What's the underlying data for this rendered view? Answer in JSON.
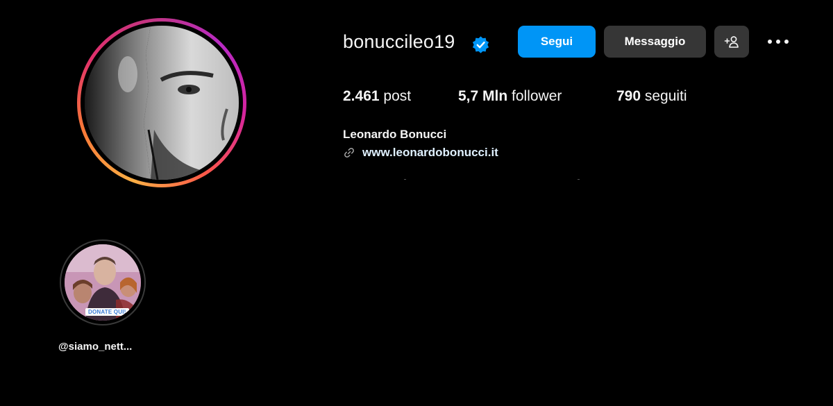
{
  "profile": {
    "username": "bonuccileo19",
    "verified": true,
    "avatar_alt": "profile picture",
    "full_name": "Leonardo Bonucci",
    "website": "www.leonardobonucci.it"
  },
  "actions": {
    "follow_label": "Segui",
    "message_label": "Messaggio",
    "suggest_icon": "add-person-icon",
    "more_icon": "more-dots-icon"
  },
  "stats": {
    "posts_value": "2.461",
    "posts_label": " post",
    "followers_value": "5,7 Mln",
    "followers_label": " follower",
    "following_value": "790",
    "following_label": " seguiti"
  },
  "highlights": [
    {
      "label": "@siamo_nett...",
      "sticker": "DONATE QUI!"
    }
  ],
  "colors": {
    "background": "#000000",
    "follow_button": "#0095f6",
    "secondary_button": "#363636",
    "verified_badge": "#0095f6",
    "text": "#f5f5f5"
  }
}
